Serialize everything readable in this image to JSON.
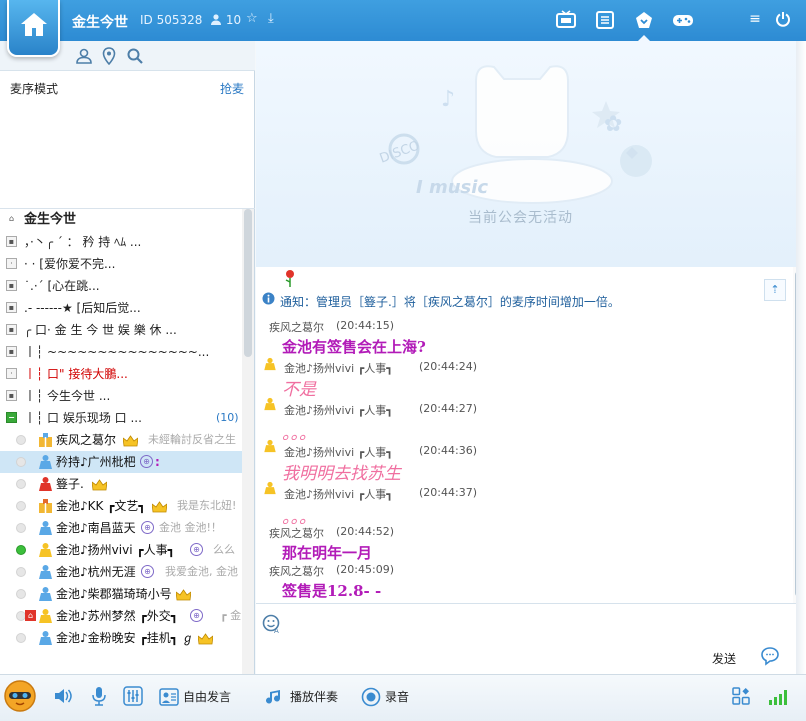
{
  "title": {
    "name": "金生今世",
    "id": "ID 505328",
    "users": "10"
  },
  "left": {
    "queue_mode": "麦序模式",
    "grab_mic": "抢麦",
    "root": "金生今世",
    "channels": [
      {
        "label": "，·丶╭ ˊ ：    矜 持 ﾍﾑ  ..."
      },
      {
        "label": "·       ·       [爱你爱不完..."
      },
      {
        "label": "     ˙.·ˊ        [心在跳..."
      },
      {
        "label": ".- ------★  [后知后觉..."
      },
      {
        "label": "╭  口· 金 生 今 世 娱 樂 休 ..."
      },
      {
        "label": "丨┆    ~~~~~~~~~~~~~~~..."
      },
      {
        "label": "丨┆            口\" 接待大鵬..."
      },
      {
        "label": "丨┆   今生今世                 ..."
      },
      {
        "label": "丨┆      口  娱乐现场  口      ...",
        "count": "(10)"
      }
    ],
    "members": [
      {
        "name": "疾风之葛尔",
        "sig": "未經輪討反省之生"
      },
      {
        "name": "矜持♪广州枇杷",
        "sig": ""
      },
      {
        "name": "簦子.",
        "sig": ""
      },
      {
        "name": "金池♪KK ┏文艺┓",
        "sig": "我是东北妞!"
      },
      {
        "name": "金池♪南昌蓝天",
        "sig": "金池 金池!！"
      },
      {
        "name": "金池♪扬州vivi ┏人事┓",
        "sig": "么么"
      },
      {
        "name": "金池♪杭州无涯",
        "sig": "我爱金池, 金池"
      },
      {
        "name": "金池♪柴郡猫琦琦小号",
        "sig": ""
      },
      {
        "name": "金池♪苏州梦然 ┏外交┓",
        "sig": "┏ 金"
      },
      {
        "name": "金池♪金粉晚安 ┏挂机┓ ℊ",
        "sig": ""
      }
    ]
  },
  "banner": {
    "no_activity": "当前公会无活动",
    "music": "I  music",
    "disco": "DISCO"
  },
  "chat": {
    "notice": "通知：管理员［簦子.］将［疾风之葛尔］的麦序时间增加一倍。",
    "messages": [
      {
        "name": "疾风之葛尔",
        "time": "(20:44:15)",
        "text": "金池有签售会在上海?"
      },
      {
        "name": "金池♪扬州vivi ┏人事┓",
        "time": "(20:44:24)",
        "text": "不是"
      },
      {
        "name": "金池♪扬州vivi ┏人事┓",
        "time": "(20:44:27)",
        "text": "。。。"
      },
      {
        "name": "金池♪扬州vivi ┏人事┓",
        "time": "(20:44:36)",
        "text": "我明明去找苏生"
      },
      {
        "name": "金池♪扬州vivi ┏人事┓",
        "time": "(20:44:37)",
        "text": "。。。"
      },
      {
        "name": "疾风之葛尔",
        "time": "(20:44:52)",
        "text": "那在明年一月"
      },
      {
        "name": "疾风之葛尔",
        "time": "(20:45:09)",
        "text": "签售是12.8- -"
      }
    ]
  },
  "input": {
    "send": "发送"
  },
  "bottom": {
    "free_speak": "自由发言",
    "play_accompany": "播放伴奏",
    "record": "录音"
  },
  "colors": {
    "accent": "#2d8bd3",
    "pink": "#f06fa0",
    "purple": "#b21bb8",
    "notice_blue": "#1f5f9c"
  }
}
